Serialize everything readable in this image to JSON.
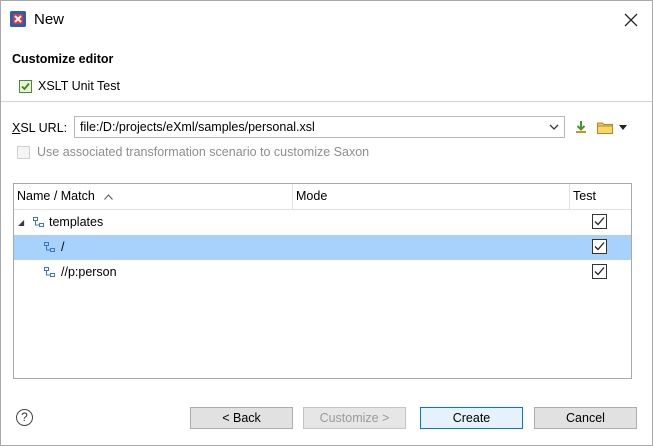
{
  "window": {
    "title": "New",
    "icon": "xslt-app-icon",
    "close_icon": "close-icon"
  },
  "header": {
    "section_title": "Customize editor",
    "document_type": "XSLT Unit Test"
  },
  "form": {
    "xsl_url_label": "XSL URL:",
    "xsl_url_value": "file:/D:/projects/eXml/samples/personal.xsl",
    "use_scenario_label": "Use associated transformation scenario to customize Saxon",
    "use_scenario_checked": false,
    "use_scenario_enabled": false
  },
  "table": {
    "columns": [
      {
        "label": "Name / Match",
        "sorted": "ascending"
      },
      {
        "label": "Mode"
      },
      {
        "label": "Test"
      }
    ],
    "rows": [
      {
        "name": "templates",
        "mode": "",
        "test": true,
        "expanded": true,
        "selected": false
      },
      {
        "name": "/",
        "mode": "",
        "test": true,
        "selected": true
      },
      {
        "name": "//p:person",
        "mode": "",
        "test": true,
        "selected": false
      }
    ]
  },
  "buttons": {
    "back": "< Back",
    "customize": "Customize >",
    "create": "Create",
    "cancel": "Cancel"
  },
  "colors": {
    "selection": "#a8d2fb",
    "default_button_border": "#0078d7"
  }
}
